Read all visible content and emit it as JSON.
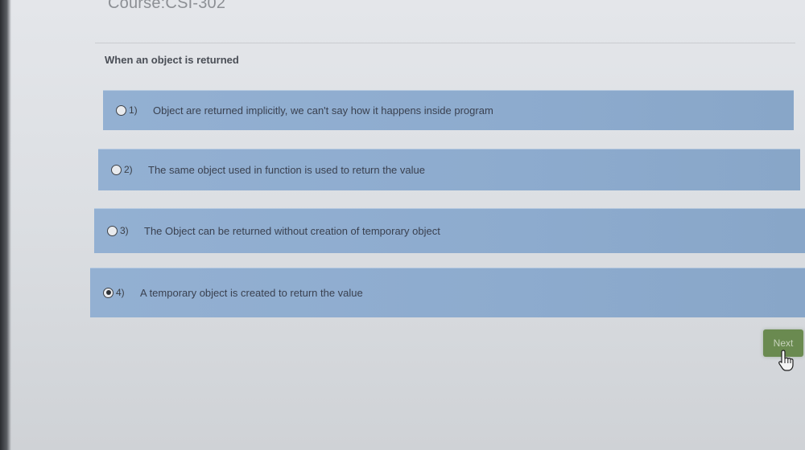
{
  "course": {
    "title": "Course:CSI-302"
  },
  "question": {
    "text": "When an object is returned"
  },
  "options": [
    {
      "number": "1)",
      "text": "Object are returned implicitly, we can't say how it happens inside program",
      "selected": false
    },
    {
      "number": "2)",
      "text": "The same object used in function is used to return the value",
      "selected": false
    },
    {
      "number": "3)",
      "text": "The Object can be returned without creation of temporary object",
      "selected": false
    },
    {
      "number": "4)",
      "text": "A temporary object is created to return the value",
      "selected": true
    }
  ],
  "navigation": {
    "next_label": "Next"
  },
  "icons": {
    "radio": "radio-button-icon",
    "cursor": "hand-pointer-icon"
  },
  "colors": {
    "option_background": "#8dabce",
    "next_button": "#6a8a50"
  }
}
